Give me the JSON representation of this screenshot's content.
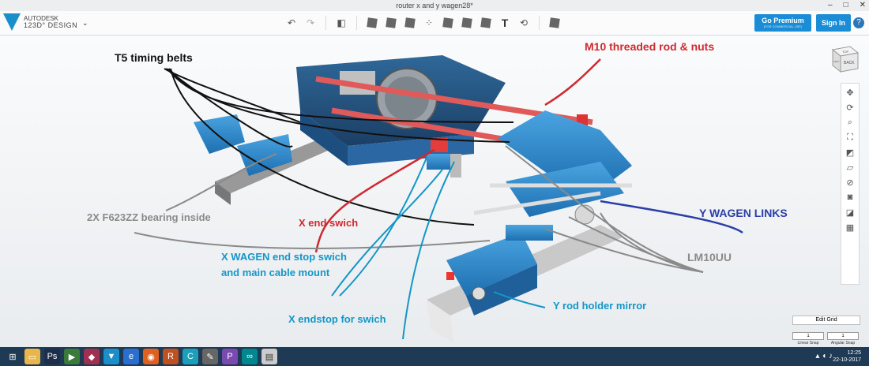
{
  "window": {
    "title": "router x and y wagen28*"
  },
  "app": {
    "brand": "AUTODESK",
    "product": "123D° DESIGN"
  },
  "header": {
    "go_premium": "Go Premium",
    "go_premium_sub": "(FOR COMMERCIAL USE)",
    "sign_in": "Sign In",
    "help": "?"
  },
  "toolbar_icons": [
    "undo-icon",
    "redo-icon",
    "primitive-icon",
    "sketch-icon",
    "construct-icon",
    "modify-icon",
    "pattern-icon",
    "group-icon",
    "combine-icon",
    "measure-icon",
    "text-icon",
    "snap-icon",
    "material-icon"
  ],
  "viewcube": {
    "top": "TOP",
    "back": "BACK",
    "left": "LEFT"
  },
  "annotations": {
    "t5": "T5 timing belts",
    "m10": "M10 threaded rod & nuts",
    "bearing": "2X F623ZZ bearing inside",
    "xend": "X end swich",
    "ylinks": "Y WAGEN LINKS",
    "xwagen1": "X WAGEN end stop swich",
    "xwagen2": "and main cable mount",
    "lm": "LM10UU",
    "yrod": "Y  rod holder mirror",
    "xendstop": "X endstop for swich"
  },
  "colors": {
    "accent": "#1a8dd6",
    "red_label": "#d0282e",
    "blue_label": "#1496c8",
    "navy_label": "#2b3ea6",
    "grey_label": "#8a8a8a"
  },
  "grid": {
    "title": "Edit Grid",
    "linear": "1",
    "angular": "1",
    "linear_label": "Linear Snap",
    "angular_label": "Angular Snap"
  },
  "taskbar": {
    "time": "12:25",
    "date": "22-10-2017"
  }
}
